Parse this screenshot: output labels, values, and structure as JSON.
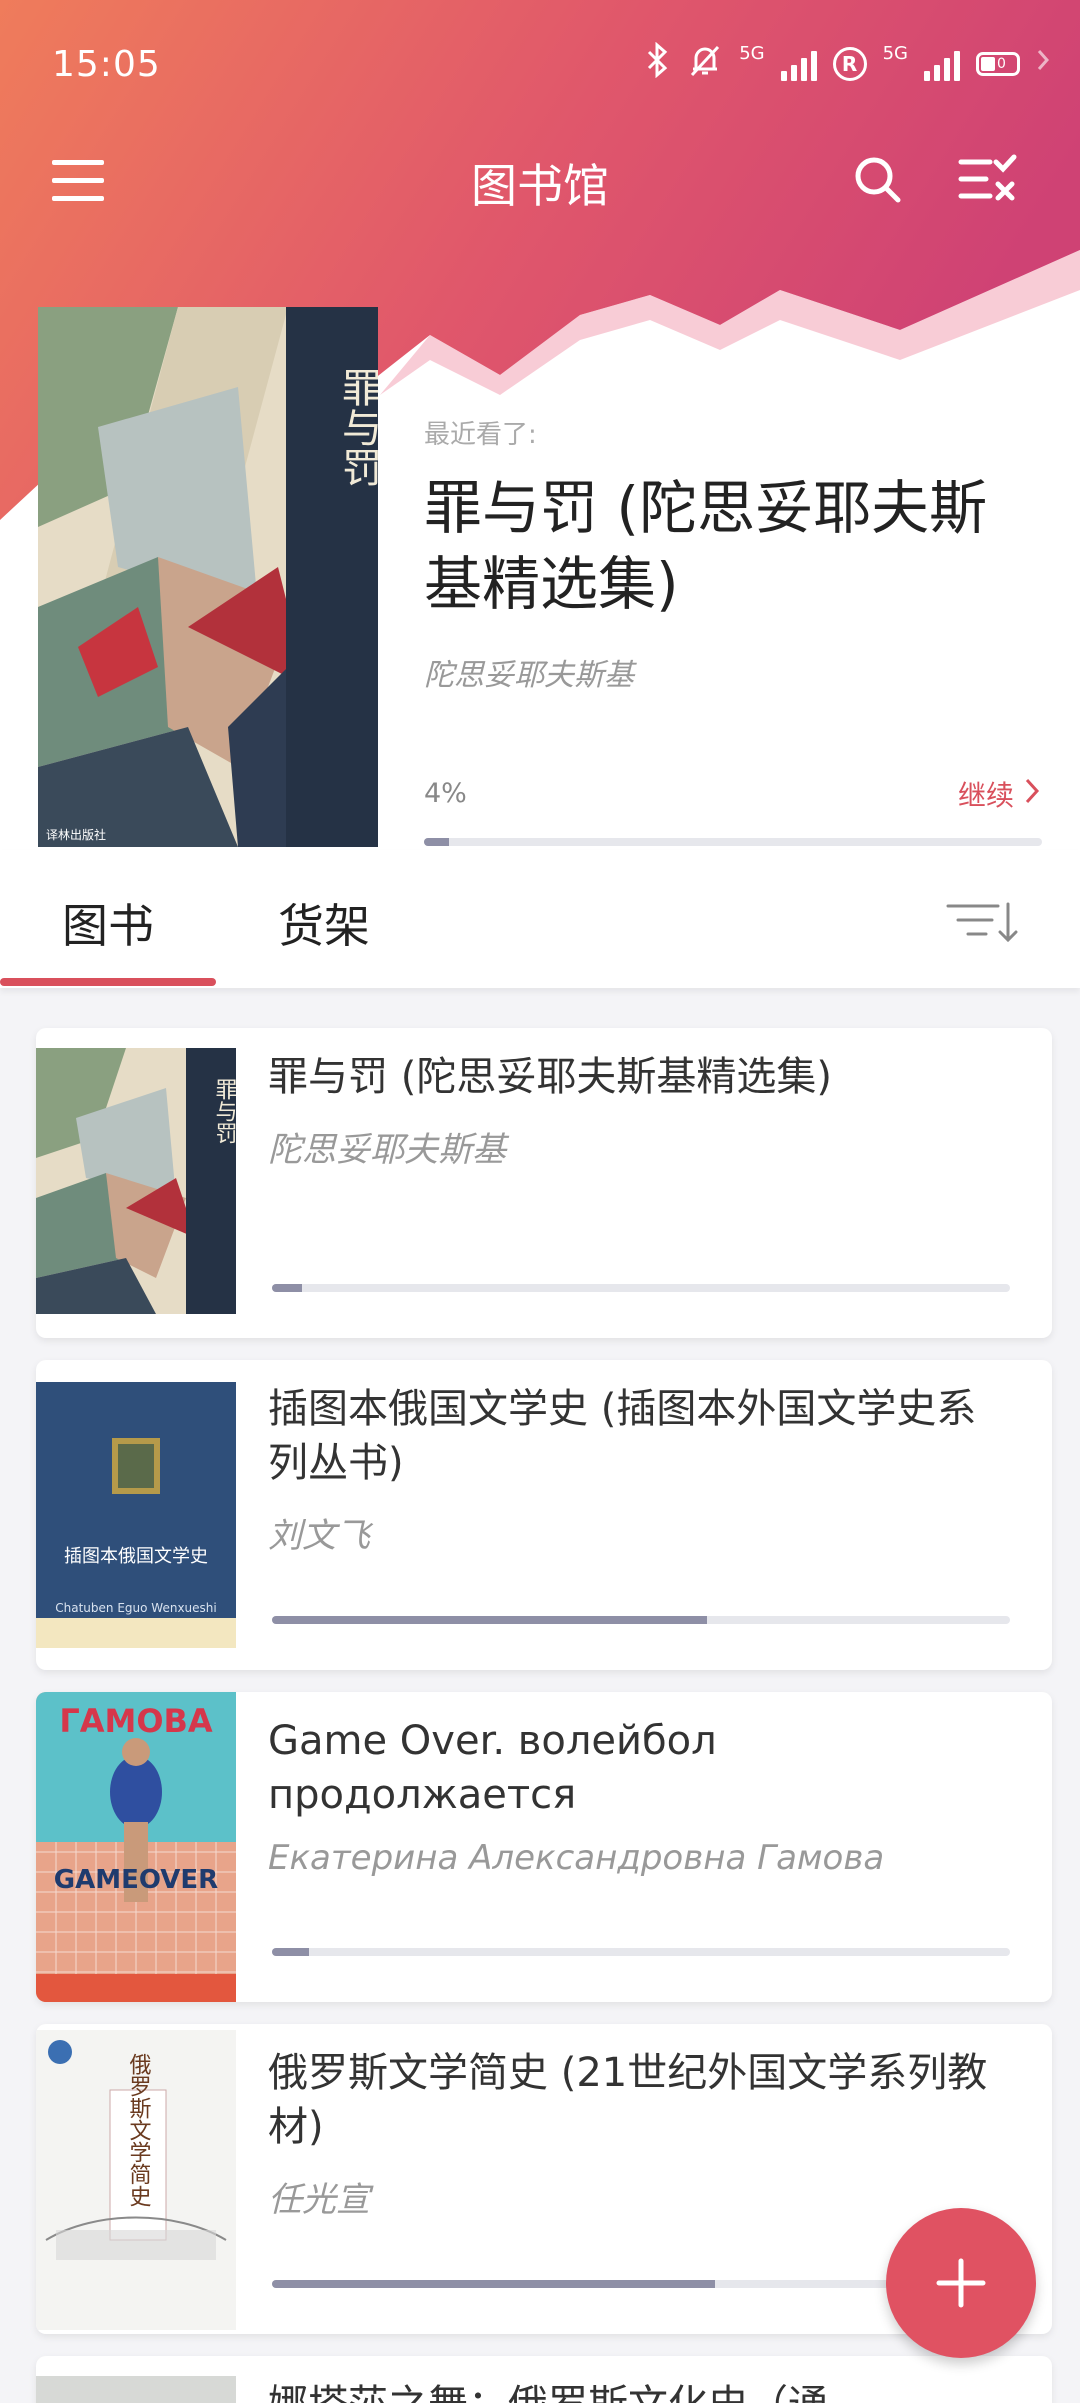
{
  "status_bar": {
    "time": "15:05",
    "net1": "5G",
    "net2": "5G",
    "battery": "0"
  },
  "app_bar": {
    "title": "图书馆"
  },
  "recent": {
    "label": "最近看了:",
    "title": "罪与罚 (陀思妥耶夫斯基精选集)",
    "author": "陀思妥耶夫斯基",
    "progress_text": "4%",
    "progress": 0.04,
    "continue_label": "继续"
  },
  "tabs": [
    {
      "label": "图书"
    },
    {
      "label": "货架"
    }
  ],
  "books": [
    {
      "title": "罪与罚 (陀思妥耶夫斯基精选集)",
      "author": "陀思妥耶夫斯基",
      "progress": 0.04,
      "cover_title": "罪与罚"
    },
    {
      "title": "插图本俄国文学史 (插图本外国文学史系列丛书)",
      "author": "刘文飞",
      "progress": 0.59,
      "cover_title": "插图本俄国文学史",
      "cover_sub": "Chatuben Eguo Wenxueshi"
    },
    {
      "title": "Game Over. волейбол продолжается",
      "author": "Екатерина Александровна Гамова",
      "progress": 0.05,
      "cover_title": "ГАМОВА",
      "cover_sub": "GAMEOVER"
    },
    {
      "title": "俄罗斯文学简史 (21世纪外国文学系列教材)",
      "author": "任光宣",
      "progress": 0.6,
      "cover_title": "俄罗斯文学简史"
    },
    {
      "title": "娜塔莎之舞：俄罗斯文化史（通"
    }
  ],
  "colors": {
    "accent": "#d9505c",
    "header_from": "#ee7a5a",
    "header_to": "#d2456f"
  }
}
